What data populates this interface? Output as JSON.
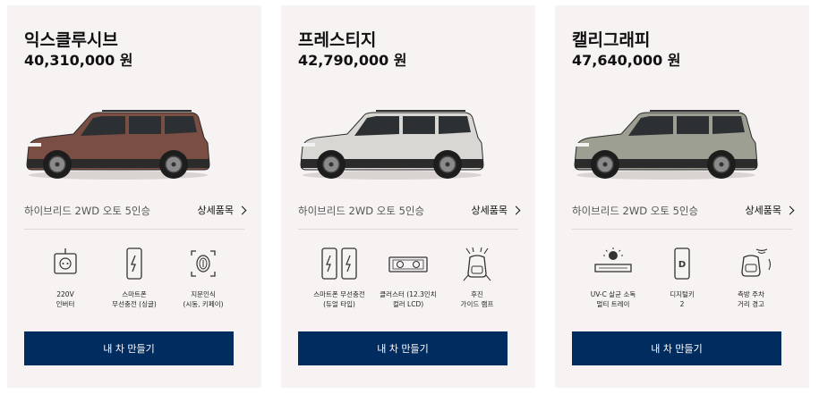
{
  "cards": [
    {
      "title": "익스클루시브",
      "price": "40,310,000 원",
      "trim": "하이브리드 2WD 오토 5인승",
      "detail_link": "상세품목",
      "body_color": "#7a4e43",
      "features": [
        {
          "icon": "power-outlet-icon",
          "label": "220V\n인버터"
        },
        {
          "icon": "smartphone-wireless-charging-icon",
          "label": "스마트폰\n무선충전 (싱글)"
        },
        {
          "icon": "fingerprint-icon",
          "label": "지문인식\n(시동, 키페이)"
        }
      ],
      "cta": "내 차 만들기"
    },
    {
      "title": "프레스티지",
      "price": "42,790,000 원",
      "trim": "하이브리드 2WD 오토 5인승",
      "detail_link": "상세품목",
      "body_color": "#d9d7d3",
      "features": [
        {
          "icon": "dual-smartphone-charging-icon",
          "label": "스마트폰 무선충전\n(듀얼 타입)"
        },
        {
          "icon": "cluster-display-icon",
          "label": "클러스터 (12.3인치\n컬러 LCD)"
        },
        {
          "icon": "rear-guide-lamp-icon",
          "label": "후진\n가이드 램프"
        }
      ],
      "cta": "내 차 만들기"
    },
    {
      "title": "캘리그래피",
      "price": "47,640,000 원",
      "trim": "하이브리드 2WD 오토 5인승",
      "detail_link": "상세품목",
      "body_color": "#9d9f92",
      "features": [
        {
          "icon": "uvc-sterilizer-tray-icon",
          "label": "UV-C 살균 소독\n멀티 트레이"
        },
        {
          "icon": "digital-key-icon",
          "label": "디지털키\n2"
        },
        {
          "icon": "side-parking-warning-icon",
          "label": "측방 주차\n거리 경고"
        }
      ],
      "cta": "내 차 만들기"
    }
  ]
}
